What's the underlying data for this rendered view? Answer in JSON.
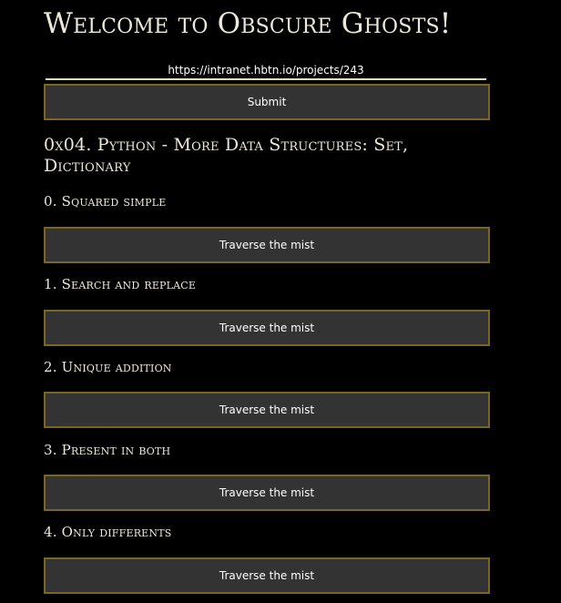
{
  "header": {
    "title": "Welcome to Obscure Ghosts!"
  },
  "url_form": {
    "url_value": "https://intranet.hbtn.io/projects/243",
    "submit_label": "Submit"
  },
  "project": {
    "title": "0x04. Python - More Data Structures: Set, Dictionary"
  },
  "tasks": [
    {
      "name": "0. Squared simple",
      "button_label": "Traverse the mist"
    },
    {
      "name": "1. Search and replace",
      "button_label": "Traverse the mist"
    },
    {
      "name": "2. Unique addition",
      "button_label": "Traverse the mist"
    },
    {
      "name": "3. Present in both",
      "button_label": "Traverse the mist"
    },
    {
      "name": "4. Only differents",
      "button_label": "Traverse the mist"
    }
  ],
  "colors": {
    "background": "#000000",
    "button_fill": "#333333",
    "button_border": "#7a6527",
    "heading_text": "#ece8da"
  }
}
